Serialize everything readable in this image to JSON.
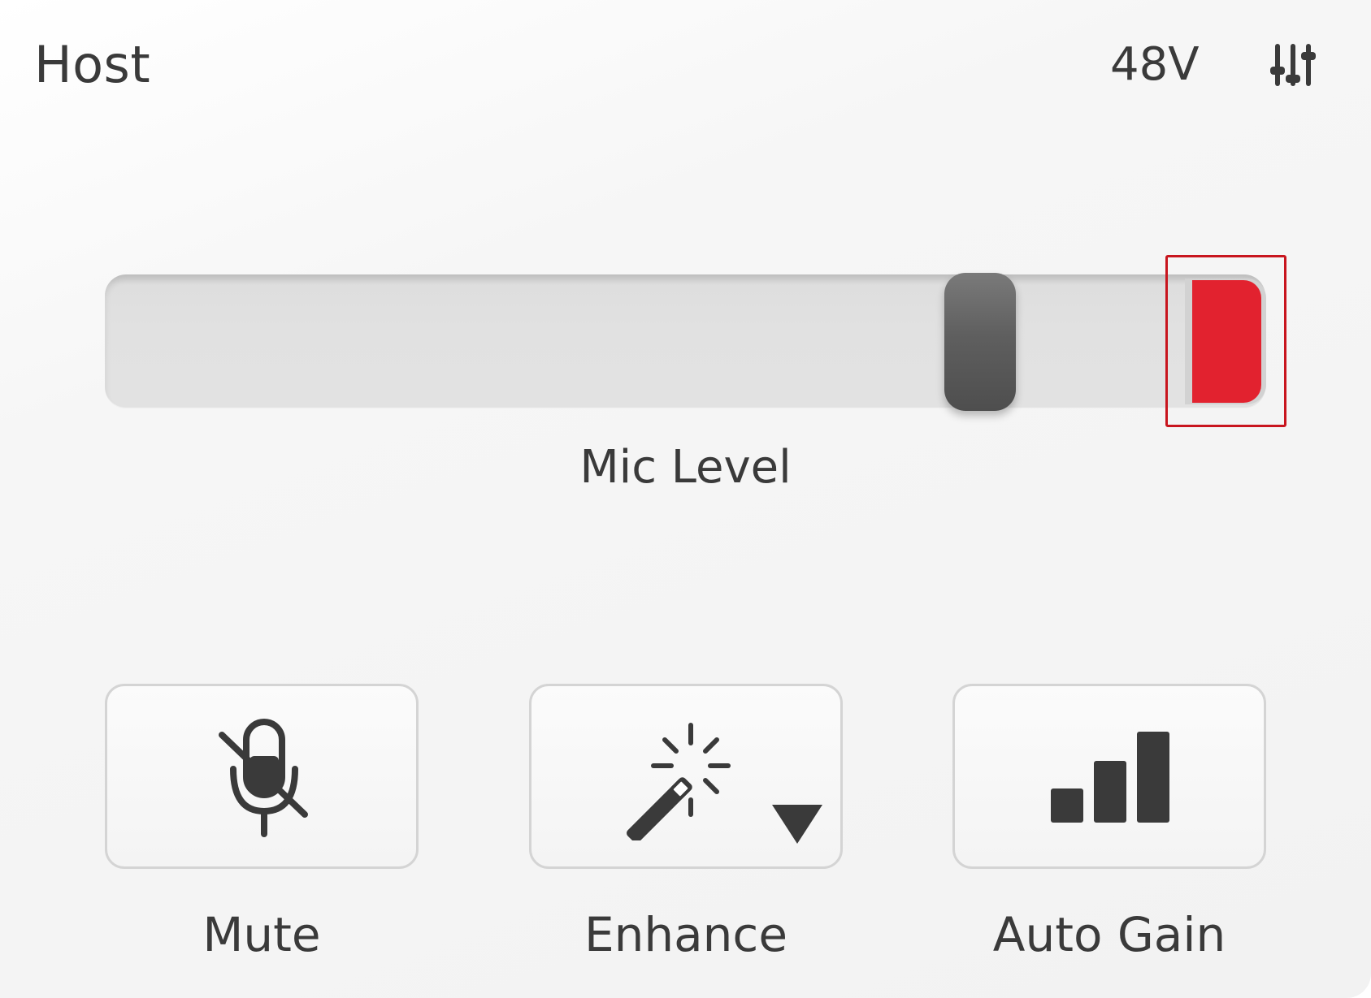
{
  "header": {
    "title": "Host",
    "phantom_power_label": "48V",
    "settings_icon": "mixer-sliders-icon"
  },
  "mic_level": {
    "label": "Mic Level",
    "slider_value_fraction": 0.7,
    "meter_color": "#e2222f"
  },
  "buttons": [
    {
      "id": "mute",
      "label": "Mute",
      "icon": "microphone-muted-icon"
    },
    {
      "id": "enhance",
      "label": "Enhance",
      "icon": "magic-wand-icon",
      "has_dropdown": true
    },
    {
      "id": "autogain",
      "label": "Auto Gain",
      "icon": "signal-bars-icon"
    }
  ],
  "colors": {
    "accent_red": "#e2222f",
    "highlight_border": "#c8151e",
    "icon_dark": "#3a3a3a"
  }
}
